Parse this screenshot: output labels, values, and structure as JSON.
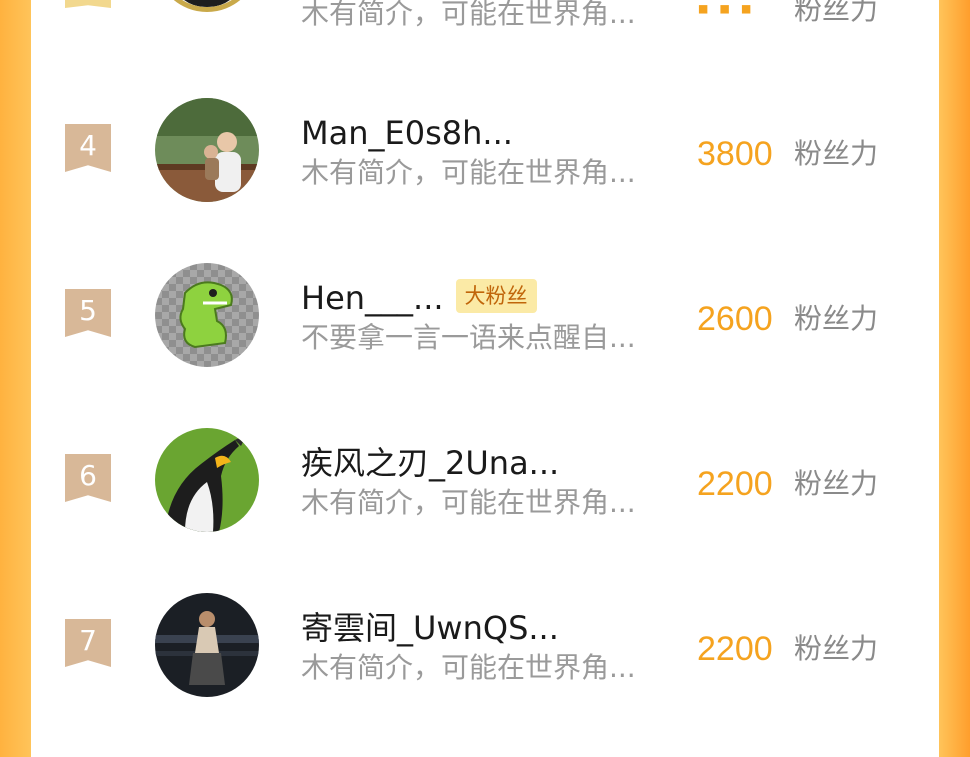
{
  "list": {
    "unit_label": "粉丝力",
    "rows": [
      {
        "rank": "4",
        "name": "Man_E0s8h...",
        "tag": "",
        "bio": "木有简介，可能在世界角...",
        "score": "3800",
        "avatar": "person-with-child-photo"
      },
      {
        "rank": "5",
        "name": "Hen___...",
        "tag": "大粉丝",
        "bio": "不要拿一言一语来点醒自...",
        "score": "2600",
        "avatar": "green-dinosaur-sticker"
      },
      {
        "rank": "6",
        "name": "疾风之刃_2Una...",
        "tag": "",
        "bio": "木有简介，可能在世界角...",
        "score": "2200",
        "avatar": "penguin-photo"
      },
      {
        "rank": "7",
        "name": "寄雲间_UwnQS...",
        "tag": "",
        "bio": "木有简介，可能在世界角...",
        "score": "2200",
        "avatar": "person-sitting-dark-photo"
      }
    ],
    "partial_top_row": {
      "bio": "木有简介，可能在世界角...",
      "unit": "粉丝力"
    }
  },
  "colors": {
    "accent": "#f5a31f",
    "badge": "#d8b898",
    "tag_bg": "#fbeaa6",
    "background": "#ffc45a"
  }
}
